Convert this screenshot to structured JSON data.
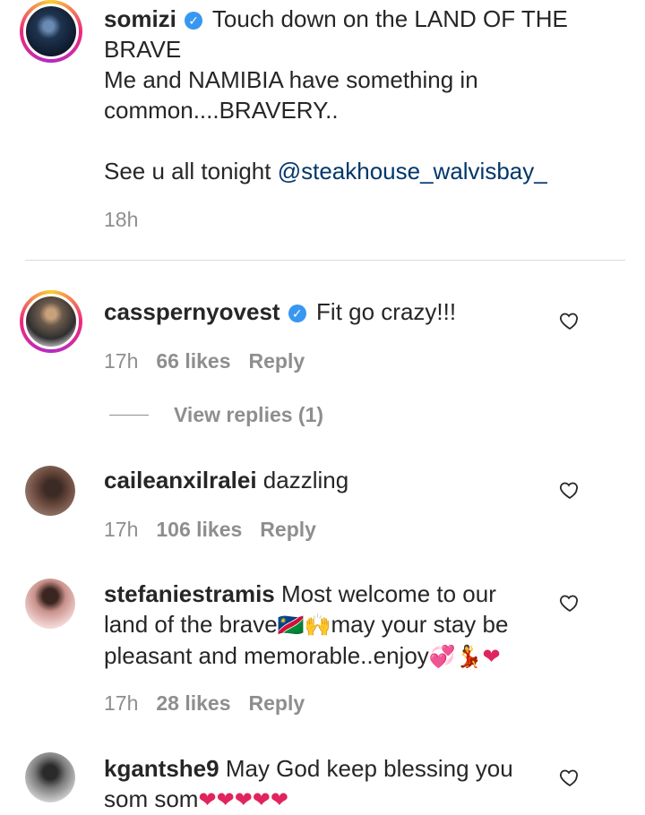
{
  "caption": {
    "username": "somizi",
    "line1": "Touch down on the LAND OF THE BRAVE",
    "line2": "Me and NAMIBIA have something in common....BRAVERY..",
    "line3_prefix": "See u all tonight ",
    "mention": "@steakhouse_walvisbay_",
    "time": "18h"
  },
  "comments": [
    {
      "username": "casspernyovest",
      "verified": true,
      "text": "Fit go crazy!!!",
      "time": "17h",
      "likes": "66 likes",
      "reply": "Reply",
      "view_replies": "View replies (1)"
    },
    {
      "username": "caileanxilralei",
      "text": "dazzling",
      "time": "17h",
      "likes": "106 likes",
      "reply": "Reply"
    },
    {
      "username": "stefaniestramis",
      "text_a": "Most welcome to our land of the brave",
      "emoji_a": "🇳🇦🙌",
      "text_b": "may your stay be pleasant and memorable..enjoy",
      "emoji_b": "💞💃❤",
      "time": "17h",
      "likes": "28 likes",
      "reply": "Reply"
    },
    {
      "username": "kgantshe9",
      "text": "May God keep blessing you som som",
      "emoji": "❤❤❤❤❤"
    }
  ],
  "icons": {
    "heart": "heart-outline-icon",
    "verified": "verified-badge-icon"
  }
}
